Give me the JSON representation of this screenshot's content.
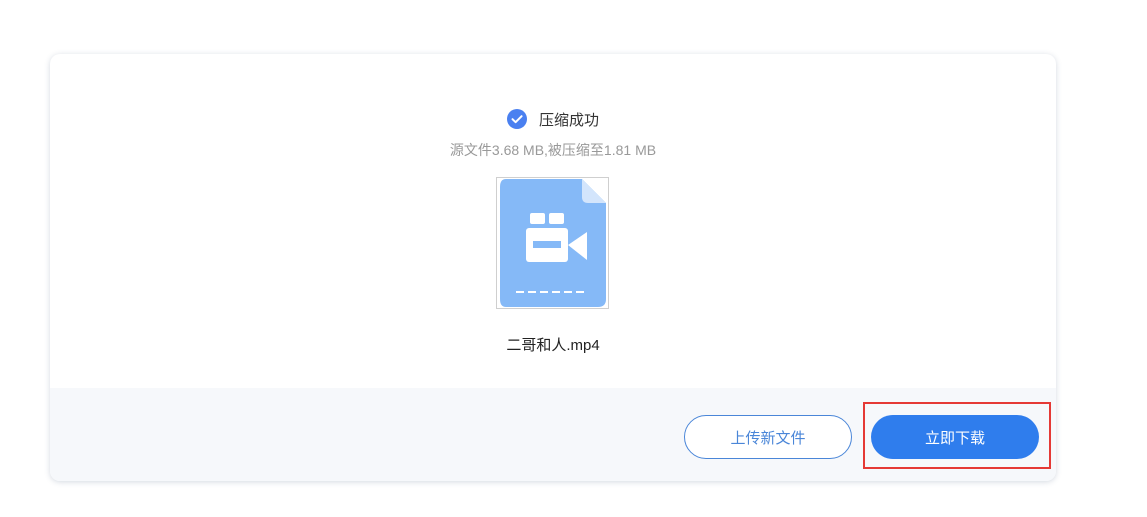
{
  "status": {
    "icon": "check-circle-icon",
    "text": "压缩成功",
    "icon_color": "#4a80f0"
  },
  "size_info": "源文件3.68 MB,被压缩至1.81 MB",
  "file": {
    "icon": "video-file-icon",
    "name": "二哥和人.mp4",
    "icon_color": "#85b9f7"
  },
  "actions": {
    "upload_label": "上传新文件",
    "download_label": "立即下载"
  },
  "colors": {
    "primary": "#2f7ded",
    "highlight": "#e53935"
  }
}
